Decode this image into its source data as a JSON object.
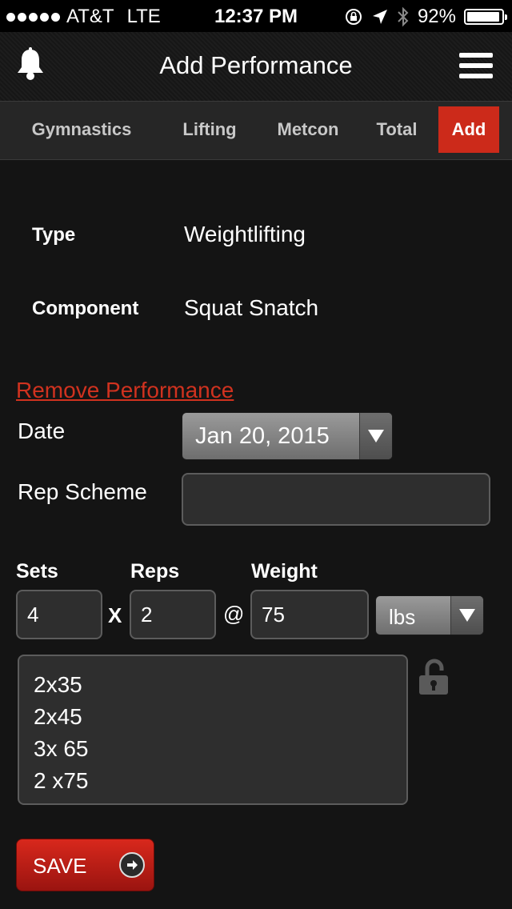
{
  "status_bar": {
    "carrier": "AT&T",
    "network": "LTE",
    "time": "12:37 PM",
    "battery_percent": "92%"
  },
  "navbar": {
    "title": "Add Performance",
    "left_icon": "bell-icon",
    "right_icon": "hamburger-menu-icon"
  },
  "tabs": [
    {
      "label": "Gymnastics"
    },
    {
      "label": "Lifting"
    },
    {
      "label": "Metcon"
    },
    {
      "label": "Total"
    },
    {
      "label": "Add"
    }
  ],
  "active_tab": "Add",
  "accent_color": "#cc2a1a",
  "form": {
    "type_label": "Type",
    "type_value": "Weightlifting",
    "component_label": "Component",
    "component_value": "Squat Snatch",
    "remove_link": "Remove Performance",
    "date_label": "Date",
    "date_value": "Jan 20, 2015",
    "rep_scheme_label": "Rep Scheme",
    "rep_scheme_value": "",
    "sets_label": "Sets",
    "reps_label": "Reps",
    "weight_label": "Weight",
    "sets_value": "4",
    "times_symbol": "X",
    "reps_value": "2",
    "at_symbol": "@",
    "weight_value": "75",
    "unit_value": "lbs",
    "notes_lines": [
      "2x35",
      "2x45",
      "3x 65",
      "2 x75"
    ],
    "lock_icon": "unlocked-padlock-icon",
    "save_label": "SAVE",
    "save_icon": "arrow-right-circle-icon"
  }
}
